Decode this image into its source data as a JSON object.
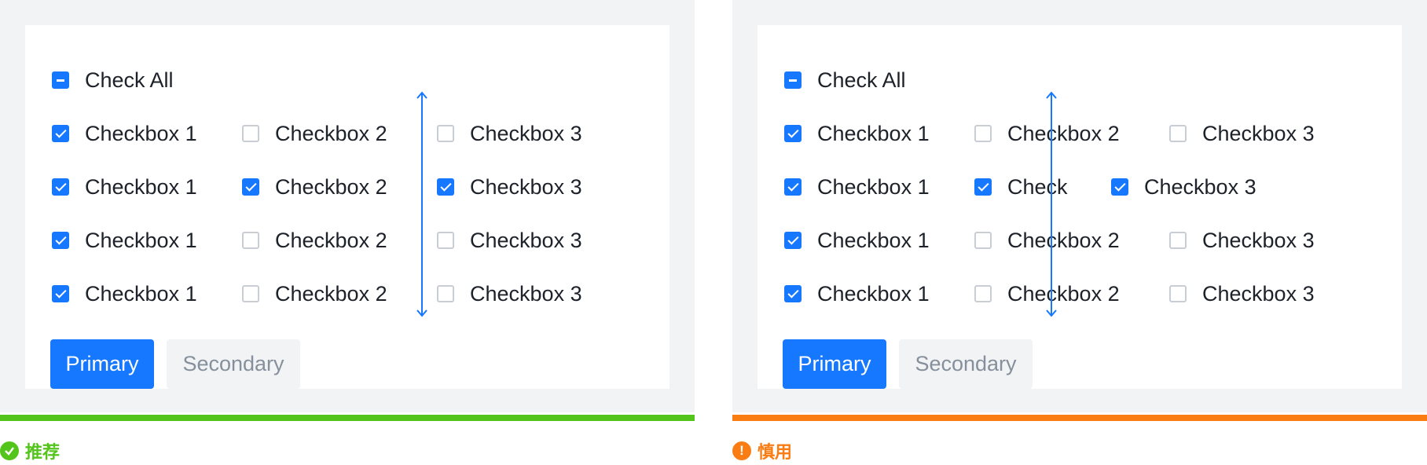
{
  "colors": {
    "accent": "#1677ff",
    "recommend": "#52c41a",
    "caution": "#fa7d14",
    "background": "#f2f3f5"
  },
  "left": {
    "check_all": {
      "label": "Check All",
      "state": "indeterminate"
    },
    "rows": [
      [
        {
          "label": "Checkbox 1",
          "checked": true
        },
        {
          "label": "Checkbox 2",
          "checked": false
        },
        {
          "label": "Checkbox 3",
          "checked": false
        }
      ],
      [
        {
          "label": "Checkbox 1",
          "checked": true
        },
        {
          "label": "Checkbox 2",
          "checked": true
        },
        {
          "label": "Checkbox 3",
          "checked": true
        }
      ],
      [
        {
          "label": "Checkbox 1",
          "checked": true
        },
        {
          "label": "Checkbox 2",
          "checked": false
        },
        {
          "label": "Checkbox 3",
          "checked": false
        }
      ],
      [
        {
          "label": "Checkbox 1",
          "checked": true
        },
        {
          "label": "Checkbox 2",
          "checked": false
        },
        {
          "label": "Checkbox 3",
          "checked": false
        }
      ]
    ],
    "primary_label": "Primary",
    "secondary_label": "Secondary",
    "status_icon": "check-circle-icon",
    "status_text": "推荐"
  },
  "right": {
    "check_all": {
      "label": "Check All",
      "state": "indeterminate"
    },
    "rows": [
      [
        {
          "label": "Checkbox 1",
          "checked": true
        },
        {
          "label": "Checkbox 2",
          "checked": false
        },
        {
          "label": "Checkbox 3",
          "checked": false
        }
      ],
      [
        {
          "label": "Checkbox 1",
          "checked": true
        },
        {
          "label": "Check",
          "checked": true
        },
        {
          "label": "Checkbox 3",
          "checked": true
        }
      ],
      [
        {
          "label": "Checkbox 1",
          "checked": true
        },
        {
          "label": "Checkbox 2",
          "checked": false
        },
        {
          "label": "Checkbox 3",
          "checked": false
        }
      ],
      [
        {
          "label": "Checkbox 1",
          "checked": true
        },
        {
          "label": "Checkbox 2",
          "checked": false
        },
        {
          "label": "Checkbox 3",
          "checked": false
        }
      ]
    ],
    "primary_label": "Primary",
    "secondary_label": "Secondary",
    "status_icon": "exclamation-circle-icon",
    "status_text": "慎用"
  }
}
